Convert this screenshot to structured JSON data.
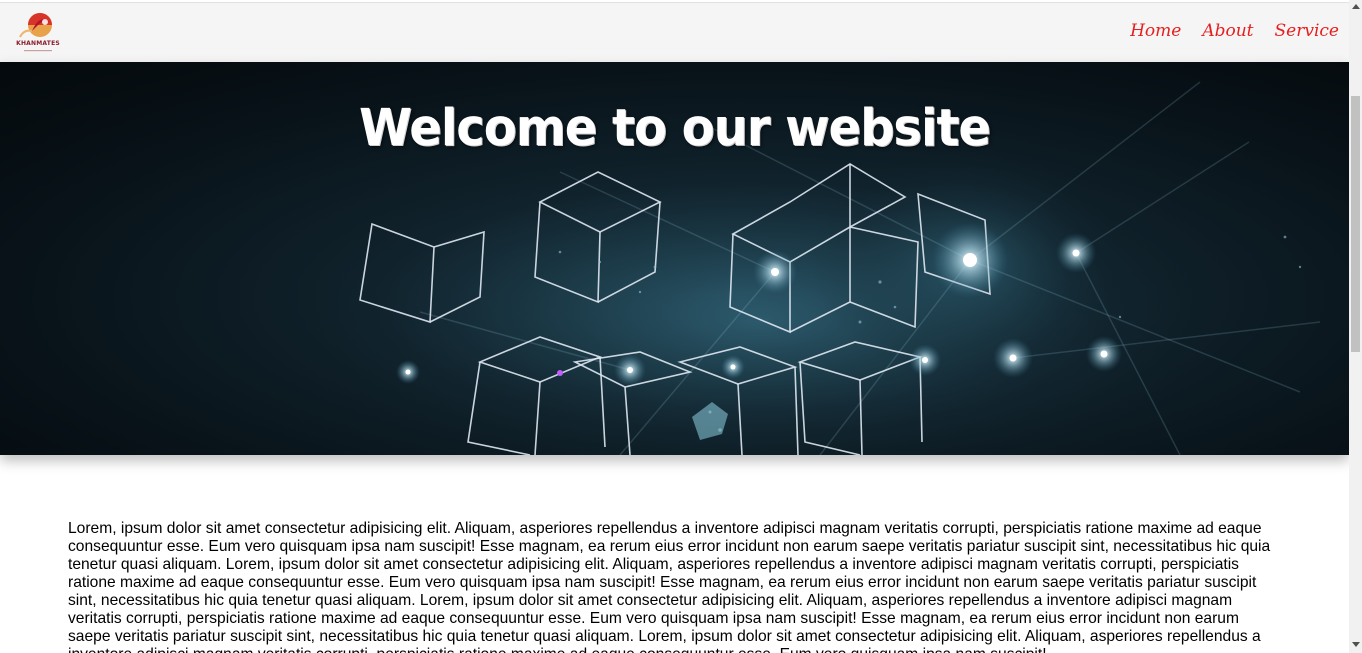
{
  "navbar": {
    "logo_text": "KHANMATES",
    "links": [
      {
        "label": "Home"
      },
      {
        "label": "About"
      },
      {
        "label": "Service"
      }
    ],
    "link_color": "#e61e1e"
  },
  "hero": {
    "title": "Welcome to our website"
  },
  "main": {
    "paragraph": "Lorem, ipsum dolor sit amet consectetur adipisicing elit. Aliquam, asperiores repellendus a inventore adipisci magnam veritatis corrupti, perspiciatis ratione maxime ad eaque consequuntur esse. Eum vero quisquam ipsa nam suscipit! Esse magnam, ea rerum eius error incidunt non earum saepe veritatis pariatur suscipit sint, necessitatibus hic quia tenetur quasi aliquam. Lorem, ipsum dolor sit amet consectetur adipisicing elit. Aliquam, asperiores repellendus a inventore adipisci magnam veritatis corrupti, perspiciatis ratione maxime ad eaque consequuntur esse. Eum vero quisquam ipsa nam suscipit! Esse magnam, ea rerum eius error incidunt non earum saepe veritatis pariatur suscipit sint, necessitatibus hic quia tenetur quasi aliquam. Lorem, ipsum dolor sit amet consectetur adipisicing elit. Aliquam, asperiores repellendus a inventore adipisci magnam veritatis corrupti, perspiciatis ratione maxime ad eaque consequuntur esse. Eum vero quisquam ipsa nam suscipit! Esse magnam, ea rerum eius error incidunt non earum saepe veritatis pariatur suscipit sint, necessitatibus hic quia tenetur quasi aliquam. Lorem, ipsum dolor sit amet consectetur adipisicing elit. Aliquam, asperiores repellendus a inventore adipisci magnam veritatis corrupti, perspiciatis ratione maxime ad eaque consequuntur esse. Eum vero quisquam ipsa nam suscipit!"
  }
}
